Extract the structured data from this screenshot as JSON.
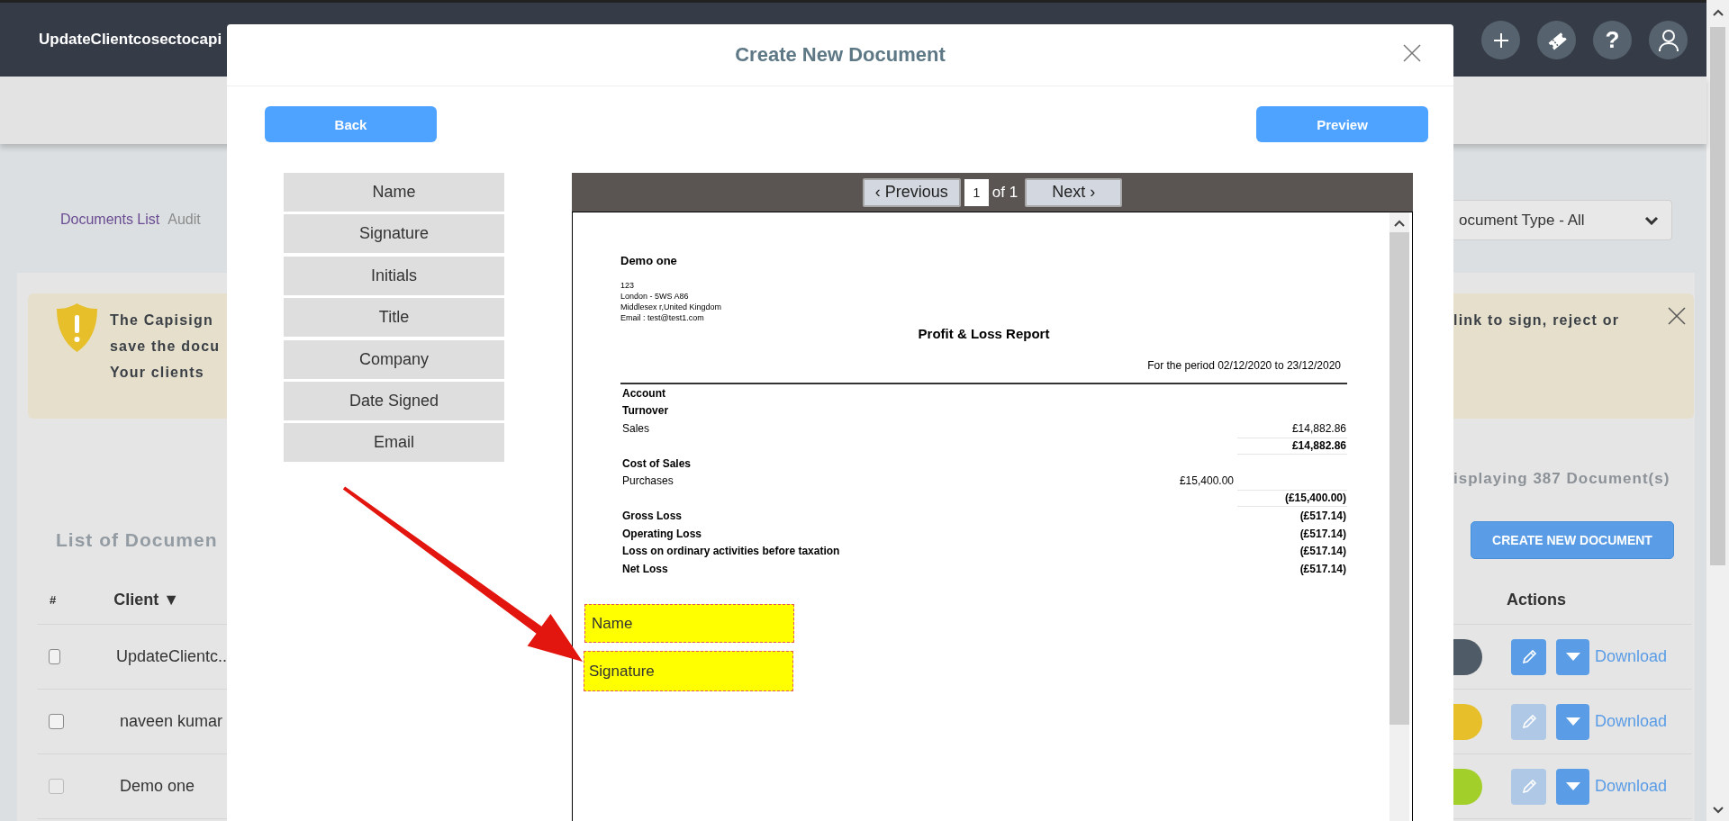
{
  "topbar": {
    "title": "UpdateClientcosectocapi",
    "buttons": [
      {
        "kind": "add"
      },
      {
        "kind": "ticket"
      },
      {
        "kind": "help",
        "label": "?"
      },
      {
        "kind": "user"
      }
    ]
  },
  "tabs": [
    {
      "label": "Documents List",
      "selected": true
    },
    {
      "label": "Audit",
      "selected": false
    }
  ],
  "filter": {
    "value": "ocument Type - All"
  },
  "alert": {
    "lines_left": [
      "The Capisign",
      "save the docu",
      "Your clients"
    ],
    "lines_right": [
      "link to sign, reject or"
    ]
  },
  "summary": "isplaying 387 Document(s)",
  "list_title": "List of Documen",
  "create_button": "CREATE NEW DOCUMENT",
  "table": {
    "columns": [
      "#",
      "Client ▼",
      "Actions"
    ],
    "rows": [
      {
        "checked": false,
        "disabled": false,
        "client": "UpdateClientc..",
        "color": "#4f5b66",
        "edit_disabled": false,
        "link": "Download"
      },
      {
        "checked": false,
        "disabled": false,
        "client": "naveen kumar",
        "color": "#e6bf2a",
        "edit_disabled": true,
        "link": "Download"
      },
      {
        "checked": false,
        "disabled": true,
        "client": "Demo one",
        "color": "#a3cf2a",
        "edit_disabled": true,
        "link": "Download"
      }
    ]
  },
  "modal": {
    "title": "Create New Document",
    "back": "Back",
    "preview": "Preview",
    "fields": [
      "Name",
      "Signature",
      "Initials",
      "Title",
      "Company",
      "Date Signed",
      "Email"
    ],
    "viewer": {
      "previous": "‹ Previous",
      "page": "1",
      "of": "of 1",
      "next": "Next ›"
    },
    "document": {
      "company": "Demo one",
      "address": [
        "123",
        "London - 5WS A86",
        "Middlesex r,United Kingdom",
        "Email : test@test1.com"
      ],
      "title": "Profit & Loss Report",
      "period": "For the period 02/12/2020  to 23/12/2020",
      "rows": [
        {
          "label": "Account",
          "bold": true
        },
        {
          "label": "Turnover",
          "bold": true
        },
        {
          "label": "Sales",
          "bold": false,
          "col2": "£14,882.86"
        },
        {
          "bold": true,
          "rule": true,
          "col2": "£14,882.86"
        },
        {
          "label": "Cost of Sales",
          "bold": true
        },
        {
          "label": "Purchases",
          "bold": false,
          "col1": "£15,400.00"
        },
        {
          "bold": true,
          "rule": true,
          "col2": "(£15,400.00)"
        },
        {
          "label": "Gross Loss",
          "bold": true,
          "col2": "(£517.14)"
        },
        {
          "label": "Operating Loss",
          "bold": true,
          "col2": "(£517.14)"
        },
        {
          "label": "Loss on ordinary activities before taxation",
          "bold": true,
          "col2": "(£517.14)"
        },
        {
          "label": "Net Loss",
          "bold": true,
          "col2": "(£517.14)"
        }
      ]
    },
    "placed_fields": [
      "Name",
      "Signature"
    ]
  }
}
